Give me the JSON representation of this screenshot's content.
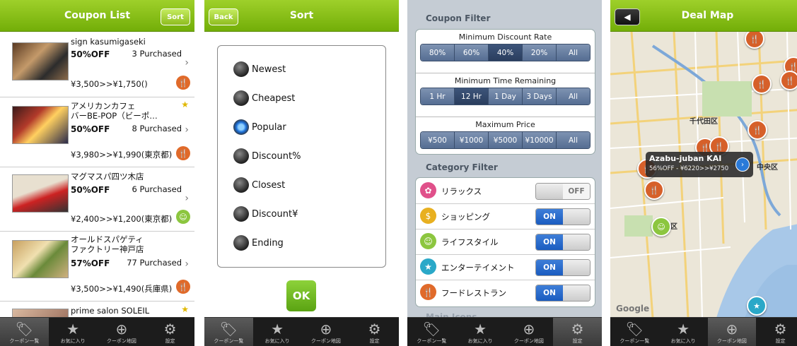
{
  "tabs": [
    {
      "label": "クーポン一覧",
      "icon": "tag-icon"
    },
    {
      "label": "お気に入り",
      "icon": "star-icon"
    },
    {
      "label": "クーポン地図",
      "icon": "target-icon"
    },
    {
      "label": "設定",
      "icon": "gear-icon"
    }
  ],
  "s1": {
    "title": "Coupon List",
    "sort_btn": "Sort",
    "items": [
      {
        "name": "sign kasumigaseki",
        "percent": "50%OFF",
        "purchased": "3 Purchased",
        "price": "¥3,500>>¥1,750()",
        "cat": "restaurant"
      },
      {
        "name": "アメリカンカフェ\nバーBE-POP（ビーポ…",
        "percent": "50%OFF",
        "purchased": "8 Purchased",
        "price": "¥3,980>>¥1,990(東京都)",
        "cat": "restaurant"
      },
      {
        "name": "マグマスパ四ツ木店",
        "percent": "50%OFF",
        "purchased": "6 Purchased",
        "price": "¥2,400>>¥1,200(東京都)",
        "cat": "lifestyle"
      },
      {
        "name": "オールドスパゲティ\nファクトリー神戸店",
        "percent": "57%OFF",
        "purchased": "77 Purchased",
        "price": "¥3,500>>¥1,490(兵庫県)",
        "cat": "restaurant"
      },
      {
        "name": "prime salon SOLEIL",
        "percent": "",
        "purchased": "",
        "price": "",
        "cat": ""
      }
    ]
  },
  "s2": {
    "title": "Sort",
    "back": "Back",
    "options": [
      "Newest",
      "Cheapest",
      "Popular",
      "Discount%",
      "Closest",
      "Discount¥",
      "Ending"
    ],
    "selected": "Popular",
    "ok": "OK"
  },
  "s3": {
    "coupon_filter": "Coupon Filter",
    "min_discount": "Minimum Discount Rate",
    "discount_opts": [
      "80%",
      "60%",
      "40%",
      "20%",
      "All"
    ],
    "min_time": "Minimum Time Remaining",
    "time_opts": [
      "1 Hr",
      "12 Hr",
      "1 Day",
      "3 Days",
      "All"
    ],
    "max_price": "Maximum Price",
    "price_opts": [
      "¥500",
      "¥1000",
      "¥5000",
      "¥10000",
      "All"
    ],
    "category_filter": "Category Filter",
    "categories": [
      {
        "label": "リラックス",
        "state": "OFF"
      },
      {
        "label": "ショッピング",
        "state": "ON"
      },
      {
        "label": "ライフスタイル",
        "state": "ON"
      },
      {
        "label": "エンターテイメント",
        "state": "ON"
      },
      {
        "label": "フードレストラン",
        "state": "ON"
      }
    ],
    "main_icons": "Main Icons"
  },
  "s4": {
    "title": "Deal Map",
    "callout_title": "Azabu-juban KAI",
    "callout_sub": "56%OFF - ¥6220>>¥2750",
    "labels": [
      "千代田区",
      "中央区",
      "区",
      "Google"
    ]
  }
}
